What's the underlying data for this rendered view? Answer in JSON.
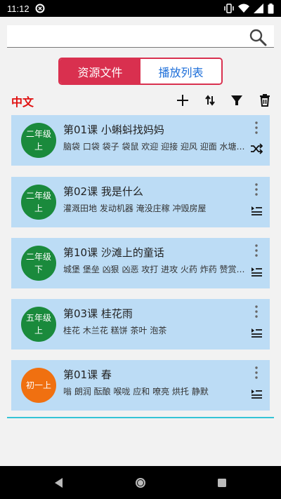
{
  "status_bar": {
    "time": "11:12"
  },
  "search": {
    "value": "",
    "placeholder": ""
  },
  "tabs": [
    {
      "label": "资源文件"
    },
    {
      "label": "播放列表"
    }
  ],
  "toolbar": {
    "language": "中文"
  },
  "items": [
    {
      "badge_line1": "二年级",
      "badge_line2": "上",
      "badge_color": "#1a8a3c",
      "title": "第01课 小蝌蚪找妈妈",
      "words": "脑袋 口袋 袋子 袋鼠 欢迎 迎接 迎风 迎面 水塘…",
      "mode_icon": "shuffle-icon"
    },
    {
      "badge_line1": "二年级",
      "badge_line2": "上",
      "badge_color": "#1a8a3c",
      "title": "第02课 我是什么",
      "words": "灌溉田地 发动机器 淹没庄稼 冲毁房屋",
      "mode_icon": "list-play-icon"
    },
    {
      "badge_line1": "二年级",
      "badge_line2": "下",
      "badge_color": "#1a8a3c",
      "title": "第10课 沙滩上的童话",
      "words": "城堡 堡垒 凶狠 凶恶 攻打 进攻 火药 炸药 赞赏…",
      "mode_icon": "list-play-icon"
    },
    {
      "badge_line1": "五年级",
      "badge_line2": "上",
      "badge_color": "#1a8a3c",
      "title": "第03课 桂花雨",
      "words": "桂花 木兰花 糕饼 茶叶 泡茶",
      "mode_icon": "list-play-icon"
    },
    {
      "badge_line1": "初一上",
      "badge_line2": "",
      "badge_color": "#f07010",
      "title": "第01课 春",
      "words": "嗡 朗润 酝酿 喉咙 应和 嘹亮 烘托 静默",
      "mode_icon": "list-play-icon"
    }
  ],
  "colors": {
    "accent": "#d9304f",
    "tab_inactive_text": "#1e6fd9",
    "card_bg": "#bcdcf5",
    "language": "#e01010",
    "divider": "#35c4d6"
  }
}
